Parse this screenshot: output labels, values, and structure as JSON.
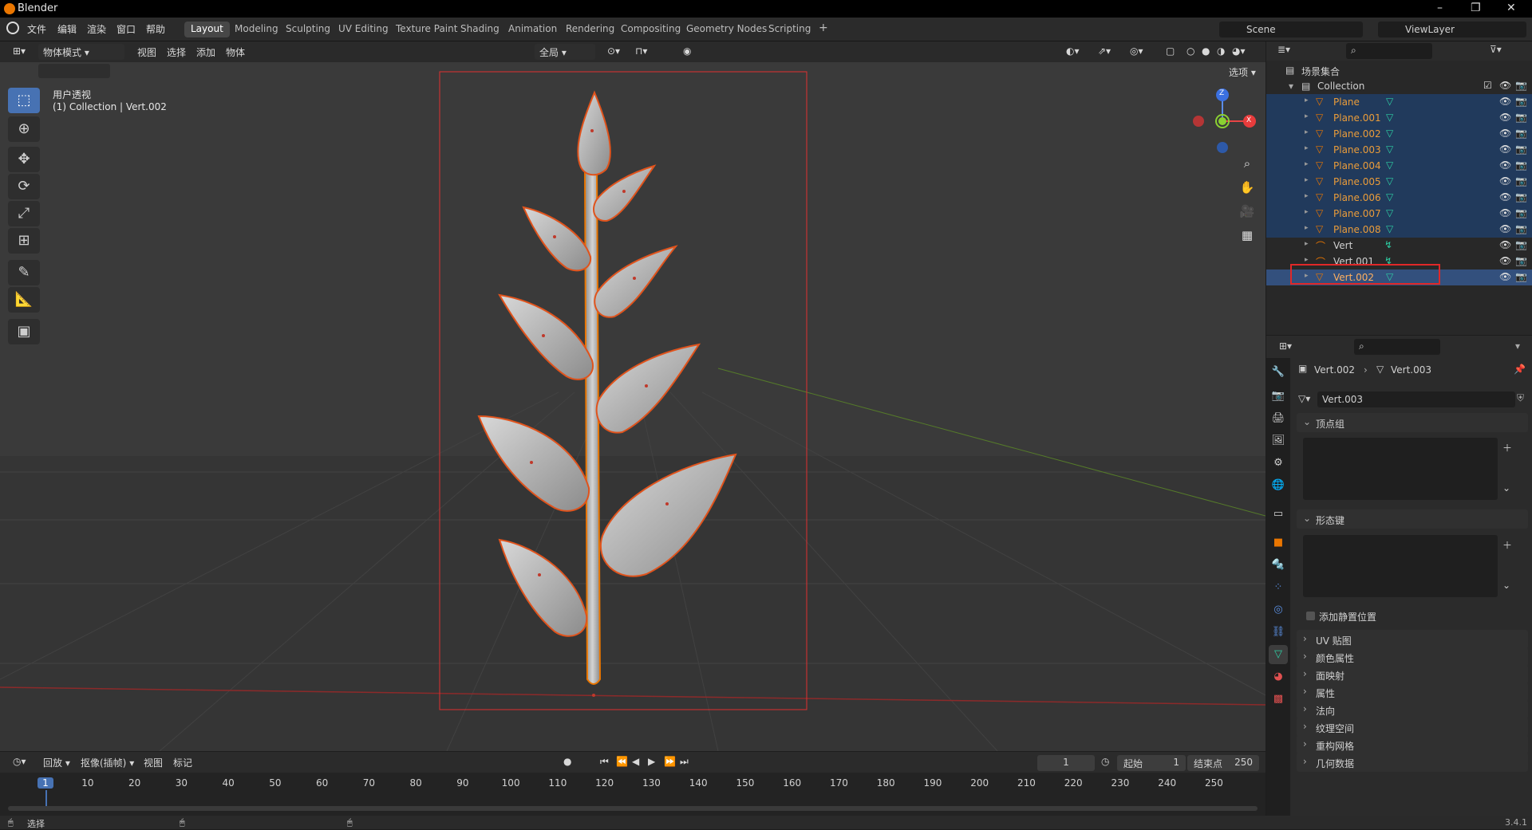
{
  "app": {
    "title": "Blender",
    "minimize": "–",
    "restore": "❐",
    "close": "✕"
  },
  "menu": [
    "文件",
    "编辑",
    "渲染",
    "窗口",
    "帮助"
  ],
  "workspaces": [
    "Layout",
    "Modeling",
    "Sculpting",
    "UV Editing",
    "Texture Paint",
    "Shading",
    "Animation",
    "Rendering",
    "Compositing",
    "Geometry Nodes",
    "Scripting",
    "+"
  ],
  "scene": "Scene",
  "viewlayer": "ViewLayer",
  "viewport": {
    "mode": "物体模式",
    "menus": [
      "视图",
      "选择",
      "添加",
      "物体"
    ],
    "transform": "全局",
    "options": "选项",
    "view_name": "用户透视",
    "collection_info": "(1) Collection | Vert.002",
    "gizmo": {
      "z": "Z",
      "x": "X"
    }
  },
  "outliner": {
    "root": "场景集合",
    "collection": "Collection",
    "items": [
      {
        "name": "Plane",
        "type": "mesh"
      },
      {
        "name": "Plane.001",
        "type": "mesh"
      },
      {
        "name": "Plane.002",
        "type": "mesh"
      },
      {
        "name": "Plane.003",
        "type": "mesh"
      },
      {
        "name": "Plane.004",
        "type": "mesh"
      },
      {
        "name": "Plane.005",
        "type": "mesh"
      },
      {
        "name": "Plane.006",
        "type": "mesh"
      },
      {
        "name": "Plane.007",
        "type": "mesh"
      },
      {
        "name": "Plane.008",
        "type": "mesh"
      },
      {
        "name": "Vert",
        "type": "curve"
      },
      {
        "name": "Vert.001",
        "type": "curve"
      },
      {
        "name": "Vert.002",
        "type": "mesh"
      }
    ]
  },
  "properties": {
    "breadcrumb_object": "Vert.002",
    "breadcrumb_data": "Vert.003",
    "datablock": "Vert.003",
    "panels_open": [
      "顶点组",
      "形态键"
    ],
    "checkbox_label": "添加静置位置",
    "panels_closed": [
      "UV 贴图",
      "颜色属性",
      "面映射",
      "属性",
      "法向",
      "纹理空间",
      "重构网格",
      "几何数据"
    ]
  },
  "timeline": {
    "menus": [
      "回放",
      "抠像(插帧)",
      "视图",
      "标记"
    ],
    "current_frame": "1",
    "start_label": "起始",
    "start": "1",
    "end_label": "结束点",
    "end": "250",
    "ticks": [
      "1",
      "10",
      "20",
      "30",
      "40",
      "50",
      "60",
      "70",
      "80",
      "90",
      "100",
      "110",
      "120",
      "130",
      "140",
      "150",
      "160",
      "170",
      "180",
      "190",
      "200",
      "210",
      "220",
      "230",
      "240",
      "250"
    ]
  },
  "status": {
    "select": "选择",
    "version": "3.4.1"
  },
  "colors": {
    "accent": "#4772b3",
    "selected_orange": "#ea7600",
    "mesh_green": "#2ecfa4",
    "outline_red": "#e03030"
  }
}
